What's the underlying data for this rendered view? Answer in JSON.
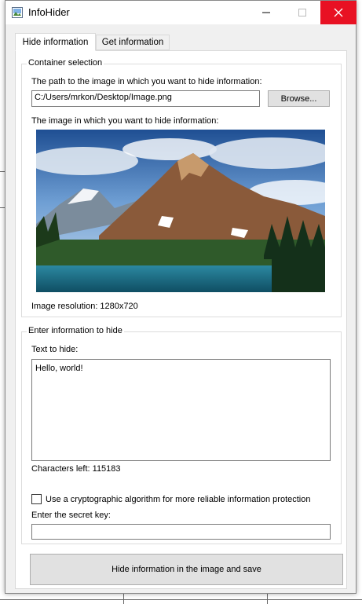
{
  "window": {
    "title": "InfoHider",
    "controls": {
      "minimize": "—",
      "maximize": "□",
      "close": "✕"
    }
  },
  "tabs": [
    {
      "label": "Hide information",
      "active": true
    },
    {
      "label": "Get information",
      "active": false
    }
  ],
  "container": {
    "group_title": "Container selection",
    "path_label": "The path to the image in which you want to hide information:",
    "path_value": "C:/Users/mrkon/Desktop/Image.png",
    "browse_label": "Browse...",
    "image_label": "The image in which you want to hide information:",
    "resolution_text": "Image resolution: 1280x720"
  },
  "info": {
    "group_title": "Enter information to hide",
    "text_label": "Text to hide:",
    "text_value": "Hello, world!",
    "chars_left": "Characters left: 115183",
    "crypto_checkbox_label": "Use a cryptographic algorithm for more reliable information protection",
    "crypto_checked": false,
    "secret_key_label": "Enter the secret key:",
    "secret_key_value": ""
  },
  "action": {
    "hide_button_label": "Hide information in the image and save"
  },
  "colors": {
    "close_button": "#e81123",
    "window_bg": "#f0f0f0",
    "panel_bg": "#ffffff"
  }
}
